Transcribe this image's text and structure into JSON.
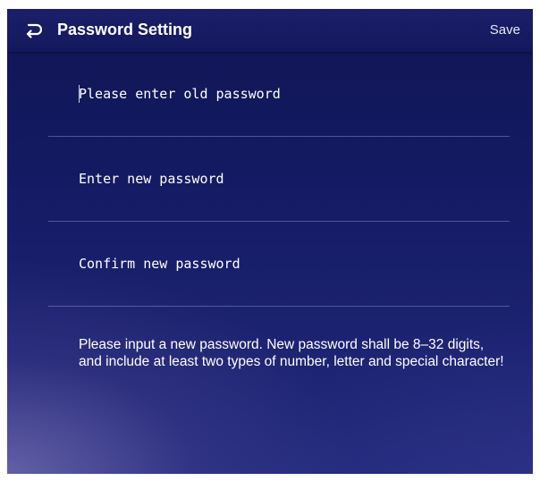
{
  "header": {
    "back_icon": "back-arrow-icon",
    "title": "Password Setting",
    "save_label": "Save"
  },
  "form": {
    "old_password": {
      "placeholder": "Please enter old password",
      "value": ""
    },
    "new_password": {
      "placeholder": "Enter new password",
      "value": ""
    },
    "confirm_password": {
      "placeholder": "Confirm new password",
      "value": ""
    }
  },
  "hint": "Please input a new password. New password shall be 8–32 digits, and include at least two types of number, letter and special character!",
  "colors": {
    "background_top": "#0f1554",
    "background_bottom": "#232a7c",
    "header": "#1b1f6a",
    "text": "#ffffff",
    "divider": "#969ddc"
  }
}
